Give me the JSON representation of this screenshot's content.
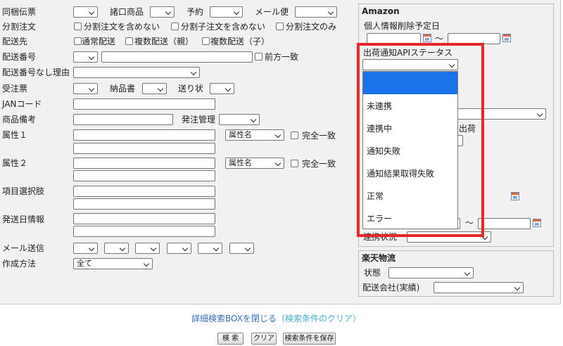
{
  "left": {
    "dokon_label": "同梱伝票",
    "shoguchi_label": "諸口商品",
    "yoyaku_label": "予約",
    "mail_bin_label": "メール便",
    "bunkatsu_label": "分割注文",
    "bunkatsu_opt1": "分割注文を含めない",
    "bunkatsu_opt2": "分割子注文を含めない",
    "bunkatsu_opt3": "分割注文のみ",
    "haisosaki_label": "配送先",
    "haisosaki_opt1": "通常配送",
    "haisosaki_opt2": "複数配送（親）",
    "haisosaki_opt3": "複数配送（子）",
    "haiso_bango_label": "配送番号",
    "zenpo_itchi_label": "前方一致",
    "haiso_nashi_label": "配送番号なし理由",
    "juchu_label": "受注票",
    "nohinsho_label": "納品書",
    "okurijo_label": "送り状",
    "jan_label": "JANコード",
    "shohin_biko_label": "商品備考",
    "hatchu_label": "発注管理",
    "zokusei1_label": "属性１",
    "zokusei2_label": "属性２",
    "zokusei_name": "属性名",
    "kanzen_itchi_label": "完全一致",
    "komoku_label": "項目選択肢",
    "hasso_label": "発送日情報",
    "mail_soshin_label": "メール送信",
    "sakusei_label": "作成方法",
    "sakusei_value": "全て"
  },
  "amazon": {
    "title": "Amazon",
    "kojin_label": "個人情報削除予定日",
    "tilde": "～",
    "api_status_label": "出荷通知APIステータス"
  },
  "hidden_fragments": {
    "shukka": "出荷",
    "tilde2": "～",
    "renkei_label": "連携状況"
  },
  "rakuten": {
    "title": "楽天物流",
    "jotai_label": "状態",
    "haiso_gaisha_label": "配送会社(実績)"
  },
  "dropdown_options": [
    "",
    "未連携",
    "連携中",
    "通知失敗",
    "通知結果取得失敗",
    "正常",
    "エラー"
  ],
  "footer": {
    "close_link": "詳細検索BOXを閉じる",
    "clear_link": "（検索条件のクリア）",
    "search_btn": "検 索",
    "clear_btn": "クリア",
    "save_btn": "検索条件を保存"
  },
  "colors": {
    "link": "#3a6fb0",
    "clear_link": "#4aaec8",
    "highlight_red": "#e8262a",
    "selected_option": "#1a73e8"
  }
}
